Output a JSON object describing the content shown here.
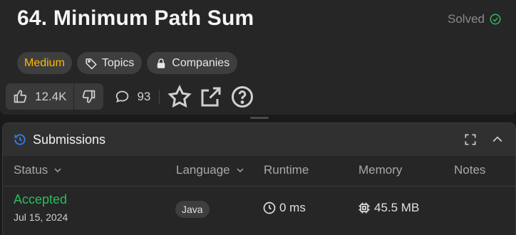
{
  "problem": {
    "title": "64. Minimum Path Sum",
    "solved_label": "Solved",
    "difficulty": "Medium",
    "topics_label": "Topics",
    "companies_label": "Companies",
    "likes": "12.4K",
    "comments": "93"
  },
  "submissions": {
    "title": "Submissions",
    "columns": {
      "status": "Status",
      "language": "Language",
      "runtime": "Runtime",
      "memory": "Memory",
      "notes": "Notes"
    },
    "rows": [
      {
        "status": "Accepted",
        "date": "Jul 15, 2024",
        "language": "Java",
        "runtime": "0 ms",
        "memory": "45.5 MB"
      }
    ]
  },
  "icons": {
    "solved": "check-circle-icon",
    "topics": "tag-icon",
    "companies": "lock-icon",
    "like": "thumbs-up-icon",
    "dislike": "thumbs-down-icon",
    "comment": "comment-icon",
    "favorite": "star-icon",
    "share": "external-link-icon",
    "help": "question-circle-icon",
    "submissions": "history-icon",
    "expand": "fullscreen-icon",
    "collapse": "chevron-up-icon",
    "runtime": "clock-icon",
    "memory": "chip-icon"
  },
  "colors": {
    "accepted": "#2cbb5d",
    "medium": "#ffb800",
    "history_icon": "#2f80ed"
  }
}
